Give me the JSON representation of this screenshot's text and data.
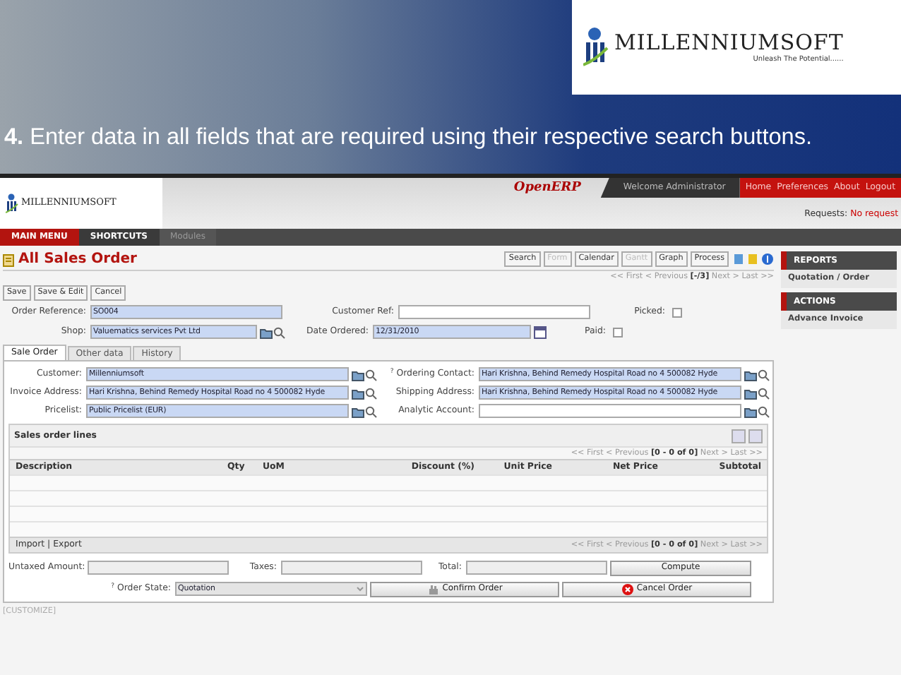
{
  "slide": {
    "logo": {
      "name": "MILLENNIUMSOFT",
      "tagline": "Unleash The Potential......"
    },
    "caption": "**4.** Enter data in all fields that are required using their respective search buttons."
  },
  "app": {
    "header": {
      "brand": "MILLENNIUMSOFT",
      "erp_logo": "OpenERP",
      "welcome": "Welcome Administrator",
      "links": [
        "Home",
        "Preferences",
        "About",
        "Logout"
      ],
      "requests_label": "Requests:",
      "requests_value": "No request"
    },
    "menu": [
      {
        "label": "MAIN MENU",
        "selected": true
      },
      {
        "label": "SHORTCUTS",
        "selected": false
      },
      {
        "label": "Modules",
        "selected": false
      }
    ],
    "title": "All Sales Order",
    "view_buttons": [
      {
        "label": "Search",
        "disabled": false
      },
      {
        "label": "Form",
        "disabled": true
      },
      {
        "label": "Calendar",
        "disabled": false
      },
      {
        "label": "Gantt",
        "disabled": true
      },
      {
        "label": "Graph",
        "disabled": false
      },
      {
        "label": "Process",
        "disabled": false
      }
    ],
    "pager": "<< First < Previous **[-/3]** Next > Last >>",
    "form_buttons": [
      "Save",
      "Save & Edit",
      "Cancel"
    ],
    "header_rows": [
      {
        "left": {
          "label": "Order Reference:",
          "value": "SO004",
          "required": true,
          "kind": "plain"
        },
        "right": {
          "label": "Customer Ref:",
          "required": false,
          "kind": "plain"
        },
        "check": {
          "label": "Picked:",
          "checked": false
        }
      },
      {
        "left": {
          "label": "Shop:",
          "value": "Valuematics services Pvt Ltd",
          "required": true,
          "kind": "lookup"
        },
        "right": {
          "label": "Date Ordered:",
          "value": "12/31/2010",
          "required": true,
          "kind": "date"
        },
        "check": {
          "label": "Paid:",
          "checked": false
        }
      }
    ],
    "tabs": [
      {
        "label": "Sale Order",
        "selected": true
      },
      {
        "label": "Other data",
        "selected": false
      },
      {
        "label": "History",
        "selected": false
      }
    ],
    "tab_rows": [
      {
        "left": {
          "label": "Customer:",
          "value": "Millenniumsoft",
          "required": true,
          "kind": "lookup"
        },
        "right": {
          "label": "Ordering Contact:",
          "help": "?",
          "value": "Hari Krishna, Behind Remedy Hospital Road no 4 500082 Hyde",
          "required": true,
          "kind": "lookup"
        }
      },
      {
        "left": {
          "label": "Invoice Address:",
          "value": "Hari Krishna, Behind Remedy Hospital Road no 4 500082 Hyde",
          "required": true,
          "kind": "lookup"
        },
        "right": {
          "label": "Shipping Address:",
          "value": "Hari Krishna, Behind Remedy Hospital Road no 4 500082 Hyde",
          "required": true,
          "kind": "lookup"
        }
      },
      {
        "left": {
          "label": "Pricelist:",
          "value": "Public Pricelist (EUR)",
          "required": true,
          "kind": "lookup"
        },
        "right": {
          "label": "Analytic Account:",
          "required": false,
          "kind": "lookup"
        }
      }
    ],
    "lines": {
      "title": "Sales order lines",
      "pager": "<< First < Previous **[0 - 0 of 0]** Next > Last >>",
      "columns": [
        "Description",
        "Qty",
        "UoM",
        "Discount (%)",
        "Unit Price",
        "Net Price",
        "Subtotal"
      ],
      "footer_links": [
        "Import",
        "|",
        "Export"
      ],
      "footer_pager": "<< First < Previous **[0 - 0 of 0]** Next > Last >>"
    },
    "totals": [
      {
        "label": "Untaxed Amount:"
      },
      {
        "label": "Taxes:"
      },
      {
        "label": "Total:"
      }
    ],
    "compute": "Compute",
    "state": {
      "label": "Order State:",
      "help": "?",
      "value": "Quotation",
      "disabled": true
    },
    "actions": [
      {
        "label": "Confirm Order",
        "kind": "confirm"
      },
      {
        "label": "Cancel Order",
        "kind": "cancel"
      }
    ],
    "customize": "[CUSTOMIZE]",
    "sidebar": [
      {
        "title": "REPORTS",
        "items": [
          "Quotation / Order"
        ]
      },
      {
        "title": "ACTIONS",
        "items": [
          "Advance Invoice"
        ]
      }
    ]
  }
}
